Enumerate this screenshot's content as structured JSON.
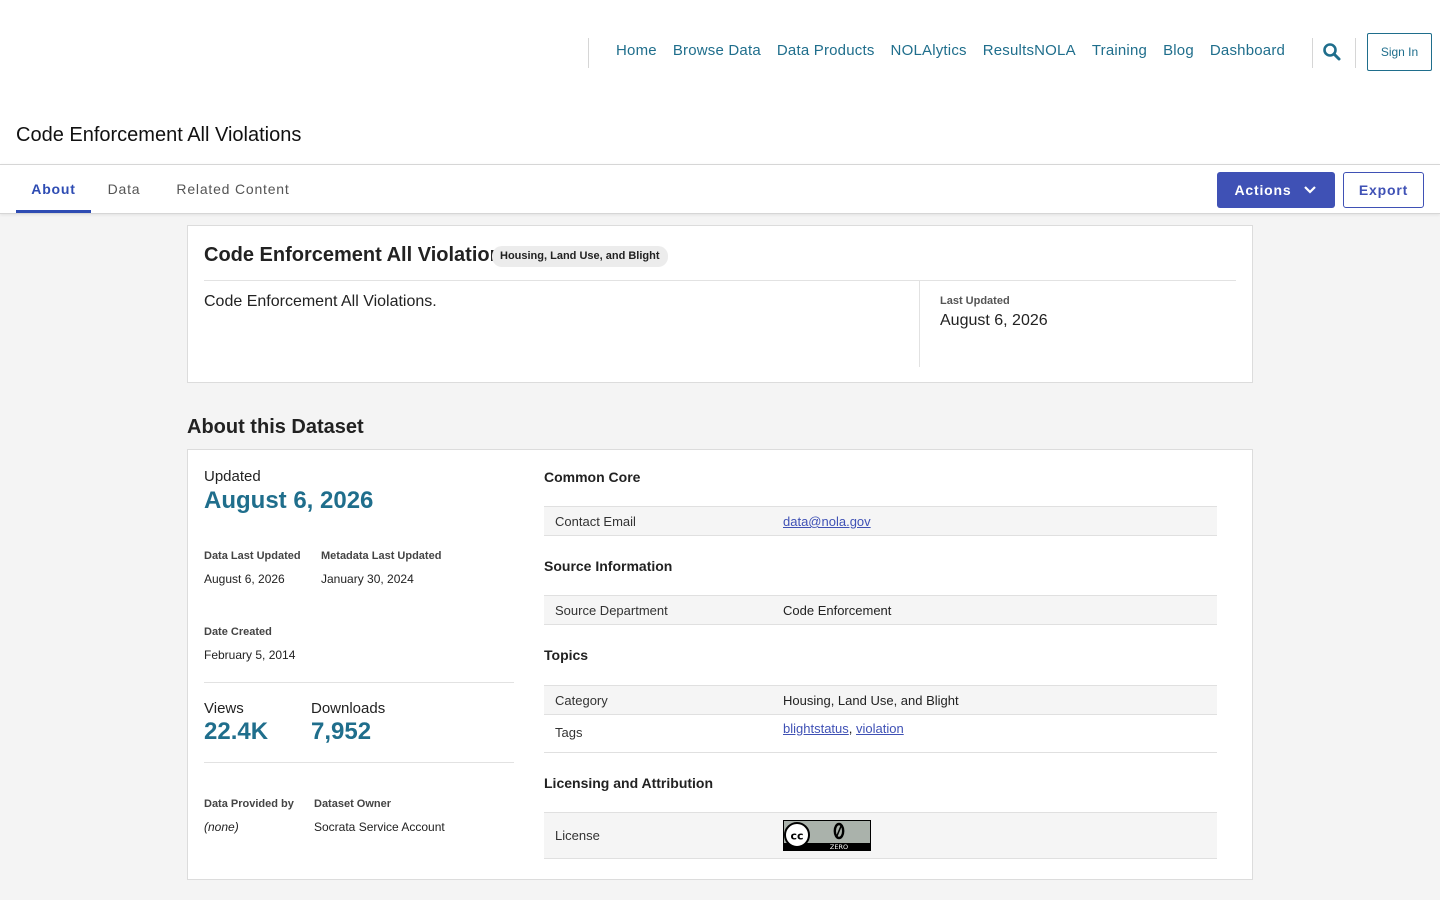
{
  "nav": {
    "links": [
      "Home",
      "Browse Data",
      "Data Products",
      "NOLAlytics",
      "ResultsNOLA",
      "Training",
      "Blog",
      "Dashboard"
    ],
    "search_icon": "search-icon",
    "sign_in": "Sign In"
  },
  "page_title": "Code Enforcement All Violations",
  "tabs": [
    {
      "label": "About",
      "active": true
    },
    {
      "label": "Data",
      "active": false
    },
    {
      "label": "Related Content",
      "active": false
    }
  ],
  "toolbar": {
    "actions_label": "Actions",
    "export_label": "Export"
  },
  "summary": {
    "title": "Code Enforcement All Violations",
    "category_badge": "Housing, Land Use, and Blight",
    "description": "Code Enforcement All Violations.",
    "last_updated_label": "Last Updated",
    "last_updated_value": "August 6, 2026"
  },
  "about": {
    "section_title": "About this Dataset",
    "updated_label": "Updated",
    "updated_value": "August 6, 2026",
    "data_last_updated_label": "Data Last Updated",
    "data_last_updated_value": "August 6, 2026",
    "metadata_last_updated_label": "Metadata Last Updated",
    "metadata_last_updated_value": "January 30, 2024",
    "date_created_label": "Date Created",
    "date_created_value": "February 5, 2014",
    "views_label": "Views",
    "views_value": "22.4K",
    "downloads_label": "Downloads",
    "downloads_value": "7,952",
    "provided_by_label": "Data Provided by",
    "provided_by_value": "(none)",
    "owner_label": "Dataset Owner",
    "owner_value": "Socrata Service Account"
  },
  "metadata": {
    "common_core_heading": "Common Core",
    "contact_email_label": "Contact Email",
    "contact_email_value": "data@nola.gov",
    "source_heading": "Source Information",
    "source_department_label": "Source Department",
    "source_department_value": "Code Enforcement",
    "topics_heading": "Topics",
    "category_label": "Category",
    "category_value": "Housing, Land Use, and Blight",
    "tags_label": "Tags",
    "tags": [
      "blightstatus",
      "violation"
    ],
    "licensing_heading": "Licensing and Attribution",
    "license_label": "License",
    "license_badge_text": "ZERO",
    "license_badge_icon": "cc-zero-badge-icon"
  },
  "colors": {
    "link": "#1f6e8c",
    "accent": "#3f51b5",
    "background": "#f4f4f4"
  }
}
